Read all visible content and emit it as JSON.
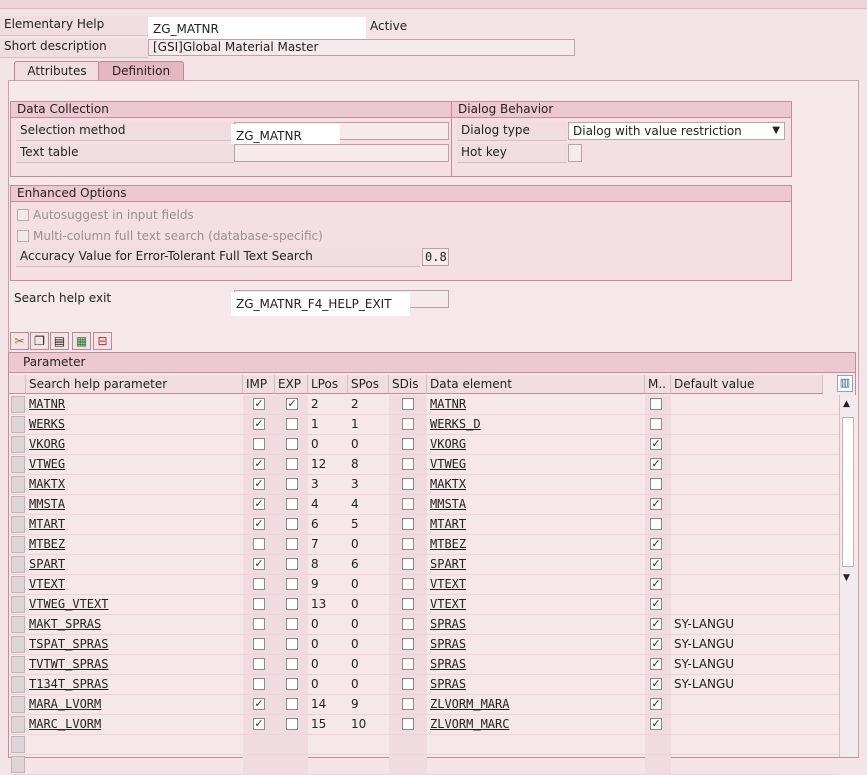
{
  "header": {
    "elementary_help_label": "Elementary Help",
    "elementary_help_value": "ZG_MATNR",
    "status": "Active",
    "short_desc_label": "Short description",
    "short_desc_value": "[GSI]Global Material Master"
  },
  "tabs": [
    {
      "label": "Attributes"
    },
    {
      "label": "Definition"
    }
  ],
  "data_collection": {
    "title": "Data Collection",
    "selection_method_label": "Selection method",
    "selection_method_value": "ZG_MATNR",
    "text_table_label": "Text table",
    "text_table_value": ""
  },
  "dialog_behavior": {
    "title": "Dialog Behavior",
    "dialog_type_label": "Dialog type",
    "dialog_type_value": "Dialog with value restriction",
    "hot_key_label": "Hot key",
    "hot_key_value": ""
  },
  "enhanced": {
    "title": "Enhanced Options",
    "autosuggest_label": "Autosuggest in input fields",
    "multicolumn_label": "Multi-column full text search (database-specific)",
    "accuracy_label": "Accuracy Value for Error-Tolerant Full Text Search",
    "accuracy_value": "0.8"
  },
  "exit": {
    "label": "Search help exit",
    "value": "ZG_MATNR_F4_HELP_EXIT"
  },
  "toolbar": {
    "icons": [
      "cut-icon",
      "copy-icon",
      "paste-icon",
      "insert-row-icon",
      "delete-row-icon"
    ],
    "glyphs": [
      "✂",
      "❐",
      "▤",
      "▦",
      "⊟"
    ]
  },
  "table": {
    "title": "Parameter",
    "columns": [
      "Search help parameter",
      "IMP",
      "EXP",
      "LPos",
      "SPos",
      "SDis",
      "Data element",
      "M..",
      "Default value"
    ],
    "rows": [
      {
        "param": "MATNR",
        "imp": true,
        "exp": true,
        "lpos": "2",
        "spos": "2",
        "sdis": false,
        "elem": "MATNR",
        "mod": false,
        "def": ""
      },
      {
        "param": "WERKS",
        "imp": true,
        "exp": false,
        "lpos": "1",
        "spos": "1",
        "sdis": false,
        "elem": "WERKS_D",
        "mod": false,
        "def": ""
      },
      {
        "param": "VKORG",
        "imp": false,
        "exp": false,
        "lpos": "0",
        "spos": "0",
        "sdis": false,
        "elem": "VKORG",
        "mod": true,
        "def": ""
      },
      {
        "param": "VTWEG",
        "imp": true,
        "exp": false,
        "lpos": "12",
        "spos": "8",
        "sdis": false,
        "elem": "VTWEG",
        "mod": true,
        "def": ""
      },
      {
        "param": "MAKTX",
        "imp": true,
        "exp": false,
        "lpos": "3",
        "spos": "3",
        "sdis": false,
        "elem": "MAKTX",
        "mod": false,
        "def": ""
      },
      {
        "param": "MMSTA",
        "imp": true,
        "exp": false,
        "lpos": "4",
        "spos": "4",
        "sdis": false,
        "elem": "MMSTA",
        "mod": true,
        "def": ""
      },
      {
        "param": "MTART",
        "imp": true,
        "exp": false,
        "lpos": "6",
        "spos": "5",
        "sdis": false,
        "elem": "MTART",
        "mod": false,
        "def": ""
      },
      {
        "param": "MTBEZ",
        "imp": false,
        "exp": false,
        "lpos": "7",
        "spos": "0",
        "sdis": false,
        "elem": "MTBEZ",
        "mod": true,
        "def": ""
      },
      {
        "param": "SPART",
        "imp": true,
        "exp": false,
        "lpos": "8",
        "spos": "6",
        "sdis": false,
        "elem": "SPART",
        "mod": true,
        "def": ""
      },
      {
        "param": "VTEXT",
        "imp": false,
        "exp": false,
        "lpos": "9",
        "spos": "0",
        "sdis": false,
        "elem": "VTEXT",
        "mod": true,
        "def": ""
      },
      {
        "param": "VTWEG_VTEXT",
        "imp": false,
        "exp": false,
        "lpos": "13",
        "spos": "0",
        "sdis": false,
        "elem": "VTEXT",
        "mod": true,
        "def": ""
      },
      {
        "param": "MAKT_SPRAS",
        "imp": false,
        "exp": false,
        "lpos": "0",
        "spos": "0",
        "sdis": false,
        "elem": "SPRAS",
        "mod": true,
        "def": "SY-LANGU"
      },
      {
        "param": "TSPAT_SPRAS",
        "imp": false,
        "exp": false,
        "lpos": "0",
        "spos": "0",
        "sdis": false,
        "elem": "SPRAS",
        "mod": true,
        "def": "SY-LANGU"
      },
      {
        "param": "TVTWT_SPRAS",
        "imp": false,
        "exp": false,
        "lpos": "0",
        "spos": "0",
        "sdis": false,
        "elem": "SPRAS",
        "mod": true,
        "def": "SY-LANGU"
      },
      {
        "param": "T134T_SPRAS",
        "imp": false,
        "exp": false,
        "lpos": "0",
        "spos": "0",
        "sdis": false,
        "elem": "SPRAS",
        "mod": true,
        "def": "SY-LANGU"
      },
      {
        "param": "MARA_LVORM",
        "imp": true,
        "exp": false,
        "lpos": "14",
        "spos": "9",
        "sdis": false,
        "elem": "ZLVORM_MARA",
        "mod": true,
        "def": ""
      },
      {
        "param": "MARC_LVORM",
        "imp": true,
        "exp": false,
        "lpos": "15",
        "spos": "10",
        "sdis": false,
        "elem": "ZLVORM_MARC",
        "mod": true,
        "def": ""
      }
    ]
  }
}
